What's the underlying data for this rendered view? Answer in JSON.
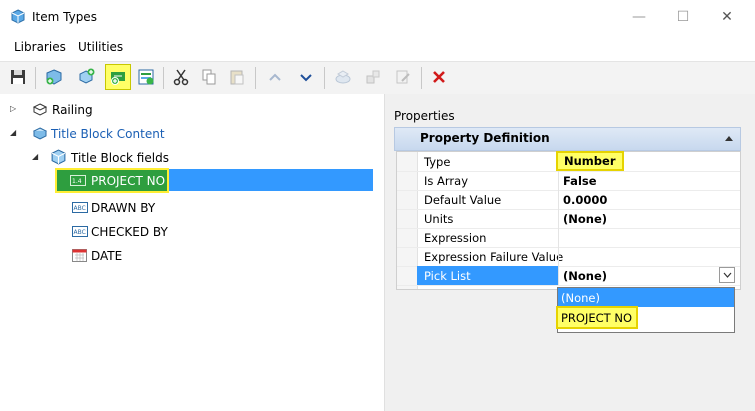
{
  "window": {
    "title": "Item Types",
    "controls": [
      "—",
      "☐",
      "✕"
    ]
  },
  "menu": {
    "items": [
      "Libraries",
      "Utilities"
    ]
  },
  "toolbar": {
    "buttons": [
      {
        "icon": "save-icon"
      },
      {
        "icon": "new-library-icon"
      },
      {
        "icon": "new-item-type-icon"
      },
      {
        "icon": "new-property-icon",
        "highlighted": true
      },
      {
        "icon": "import-icon"
      },
      {
        "icon": "cut-icon"
      },
      {
        "icon": "copy-icon"
      },
      {
        "icon": "paste-icon"
      },
      {
        "icon": "move-up-icon"
      },
      {
        "icon": "move-down-icon"
      },
      {
        "icon": "attach-icon"
      },
      {
        "icon": "detach-icon"
      },
      {
        "icon": "edit-icon"
      },
      {
        "icon": "delete-icon"
      }
    ]
  },
  "tree": {
    "items": [
      {
        "label": "Railing",
        "level": 0,
        "expanded": false
      },
      {
        "label": "Title Block Content",
        "level": 0,
        "expanded": true
      },
      {
        "label": "Title Block fields",
        "level": 1,
        "expanded": true
      },
      {
        "label": "PROJECT NO",
        "level": 2,
        "selected": true
      },
      {
        "label": "DRAWN BY",
        "level": 2
      },
      {
        "label": "CHECKED BY",
        "level": 2
      },
      {
        "label": "DATE",
        "level": 2
      }
    ]
  },
  "properties": {
    "section_label": "Properties",
    "group_title": "Property Definition",
    "rows": [
      {
        "name": "Type",
        "value": "Number"
      },
      {
        "name": "Is Array",
        "value": "False"
      },
      {
        "name": "Default Value",
        "value": "0.0000"
      },
      {
        "name": "Units",
        "value": "(None)"
      },
      {
        "name": "Expression",
        "value": ""
      },
      {
        "name": "Expression Failure Value",
        "value": ""
      },
      {
        "name": "Pick List",
        "value": "(None)"
      }
    ],
    "picklist_options": [
      "(None)",
      "PROJECT NO"
    ],
    "picklist_selected_index": 0
  },
  "colors": {
    "selection_blue": "#3399ff",
    "tree_selected_green": "#2e9e3f",
    "highlight_yellow": "#ffff66",
    "link_blue": "#1a5fb4",
    "delete_red": "#d11a1a"
  }
}
